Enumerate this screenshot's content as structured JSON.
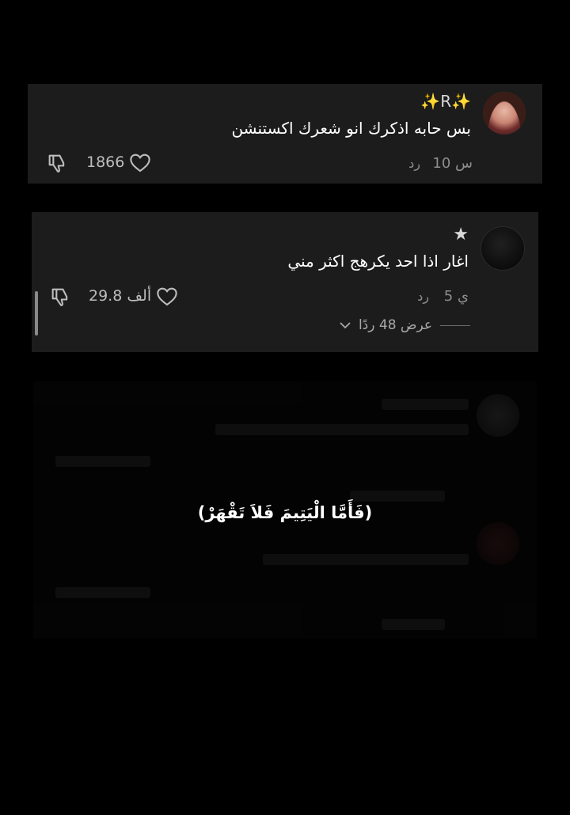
{
  "comments": [
    {
      "username": "✨R✨",
      "text": "بس حابه اذكرك انو شعرك اكستنشن",
      "time": "10 س",
      "reply_label": "رد",
      "likes": "1866",
      "avatar_icon": "profile-photo-icon"
    },
    {
      "username": "★",
      "text": "اغار اذا احد يكرهج اكثر مني",
      "time": "5 ي",
      "reply_label": "رد",
      "likes": "29.8 ألف",
      "view_replies": "عرض 48 ردًا",
      "avatar_icon": "profile-photo-icon"
    }
  ],
  "overlay": {
    "verse": "(فَأَمَّا الْيَتِيمَ فَلاَ تَقْهَرْ)"
  },
  "colors": {
    "background": "#000000",
    "card": "#1c1c1c",
    "muted_text": "#8e8e8e"
  }
}
